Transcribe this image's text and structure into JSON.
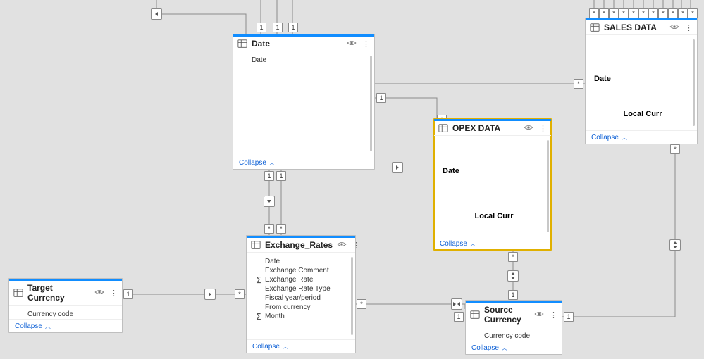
{
  "collapse_label": "Collapse",
  "tables": {
    "target_currency": {
      "title": "Target Currency",
      "fields": [
        "Currency code"
      ]
    },
    "date": {
      "title": "Date",
      "fields": [
        "Date"
      ]
    },
    "exchange_rates": {
      "title": "Exchange_Rates",
      "fields": [
        {
          "name": "Date"
        },
        {
          "name": "Exchange Comment"
        },
        {
          "name": "Exchange Rate",
          "agg": true
        },
        {
          "name": "Exchange Rate Type"
        },
        {
          "name": "Fiscal year/period"
        },
        {
          "name": "From currency"
        },
        {
          "name": "Month",
          "agg": true
        }
      ]
    },
    "opex": {
      "title": "OPEX DATA",
      "key_fields": [
        "Date",
        "Local Curr"
      ]
    },
    "sales": {
      "title": "SALES DATA",
      "key_fields": [
        "Date",
        "Local Curr"
      ]
    },
    "source_currency": {
      "title": "Source Currency",
      "fields": [
        "Currency code"
      ]
    }
  },
  "relationships": [
    {
      "from": "target_currency",
      "to": "exchange_rates",
      "card": "1:*"
    },
    {
      "from": "date",
      "to": "exchange_rates",
      "card": "1:*"
    },
    {
      "from": "date",
      "to": "opex",
      "card": "1:*"
    },
    {
      "from": "date",
      "to": "sales",
      "card": "1:*"
    },
    {
      "from": "exchange_rates",
      "to": "source_currency",
      "card": "*:1"
    },
    {
      "from": "source_currency",
      "to": "opex",
      "card": "1:*"
    },
    {
      "from": "source_currency",
      "to": "sales",
      "card": "1:*"
    },
    {
      "from": "date",
      "to": "above_1",
      "card": "1:?",
      "offscreen": true
    },
    {
      "from": "date",
      "to": "above_2",
      "card": "1:?",
      "offscreen": true
    },
    {
      "from": "date",
      "to": "above_3",
      "card": "1:?",
      "offscreen": true
    },
    {
      "from": "date",
      "to": "above_left",
      "card": "1:?",
      "offscreen": true
    },
    {
      "from": "sales",
      "to": "above_many",
      "card": "*:?",
      "offscreen": true
    }
  ]
}
